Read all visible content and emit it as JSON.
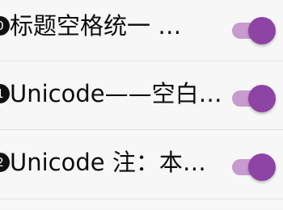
{
  "settings": {
    "items": [
      {
        "badge": "0",
        "label": "标题空格统一   …",
        "enabled": true
      },
      {
        "badge": "1",
        "label": "Unicode——空白…",
        "enabled": true
      },
      {
        "badge": "2",
        "label": "Unicode   注：本…",
        "enabled": true
      }
    ]
  },
  "colors": {
    "background": "#f7f7f7",
    "switch_track_on": "#c79bcf",
    "switch_thumb_on": "#8e44a4",
    "divider": "#e1e1e1"
  }
}
